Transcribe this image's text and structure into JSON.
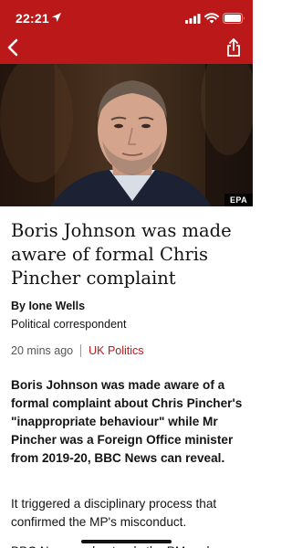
{
  "status_bar": {
    "time": "22:21"
  },
  "nav": {
    "back_icon": "chevron-left-icon",
    "share_icon": "share-icon",
    "accent_color": "#bb1919"
  },
  "hero": {
    "credit": "EPA"
  },
  "article": {
    "headline": "Boris Johnson was made aware of formal Chris Pincher complaint",
    "byline": "By Ione Wells",
    "role": "Political correspondent",
    "time_ago": "20 mins ago",
    "topic": "UK Politics",
    "intro": "Boris Johnson was made aware of a formal complaint about Chris Pincher's \"inappropriate behaviour\" while Mr Pincher was a Foreign Office minister from 2019-20, BBC News can reveal.",
    "paragraph_1": "It triggered a disciplinary process that confirmed the MP's misconduct.",
    "paragraph_2": "BBC News understands the PM and"
  }
}
